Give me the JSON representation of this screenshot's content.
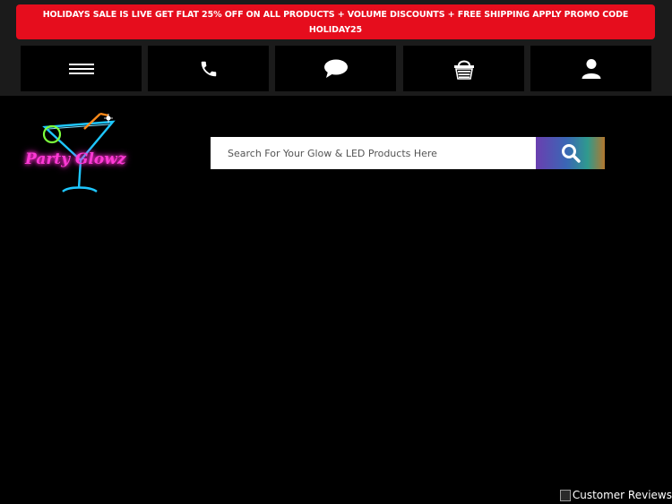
{
  "promo_banner": {
    "text": "HOLIDAYS SALE IS LIVE GET FLAT 25% OFF ON ALL PRODUCTS + VOLUME DISCOUNTS + FREE SHIPPING APPLY PROMO CODE HOLIDAY25",
    "background": "#e60d1d"
  },
  "nav": {
    "items": [
      {
        "icon": "hamburger-menu-icon"
      },
      {
        "icon": "phone-icon"
      },
      {
        "icon": "chat-bubble-icon"
      },
      {
        "icon": "shopping-basket-icon"
      },
      {
        "icon": "user-icon"
      }
    ]
  },
  "logo": {
    "text_line": "Party Glowz",
    "icon": "martini-glass-icon"
  },
  "search": {
    "placeholder": "Search For Your Glow & LED Products Here",
    "button_icon": "search-icon"
  },
  "reviews_badge": {
    "alt_text": "Customer Reviews"
  }
}
